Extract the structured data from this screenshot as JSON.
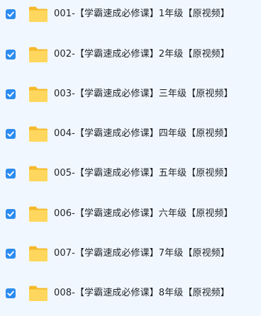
{
  "files": [
    {
      "name": "001-【学霸速成必修课】1年级【原视频】",
      "checked": true,
      "icon": "folder-icon"
    },
    {
      "name": "002-【学霸速成必修课】2年级【原视频】",
      "checked": true,
      "icon": "folder-icon"
    },
    {
      "name": "003-【学霸速成必修课】三年级【原视频】",
      "checked": true,
      "icon": "folder-icon"
    },
    {
      "name": "004-【学霸速成必修课】四年级【原视频】",
      "checked": true,
      "icon": "folder-icon"
    },
    {
      "name": "005-【学霸速成必修课】五年级【原视频】",
      "checked": true,
      "icon": "folder-icon"
    },
    {
      "name": "006-【学霸速成必修课】六年级【原视频】",
      "checked": true,
      "icon": "folder-icon"
    },
    {
      "name": "007-【学霸速成必修课】7年级【原视频】",
      "checked": true,
      "icon": "folder-icon"
    },
    {
      "name": "008-【学霸速成必修课】8年级【原视频】",
      "checked": true,
      "icon": "folder-icon"
    }
  ],
  "colors": {
    "background": "#f1f7ff",
    "checkbox": "#2d8cf0",
    "folder_back": "#f5b92b",
    "folder_front": "#ffd75e",
    "text": "#1e2226"
  }
}
